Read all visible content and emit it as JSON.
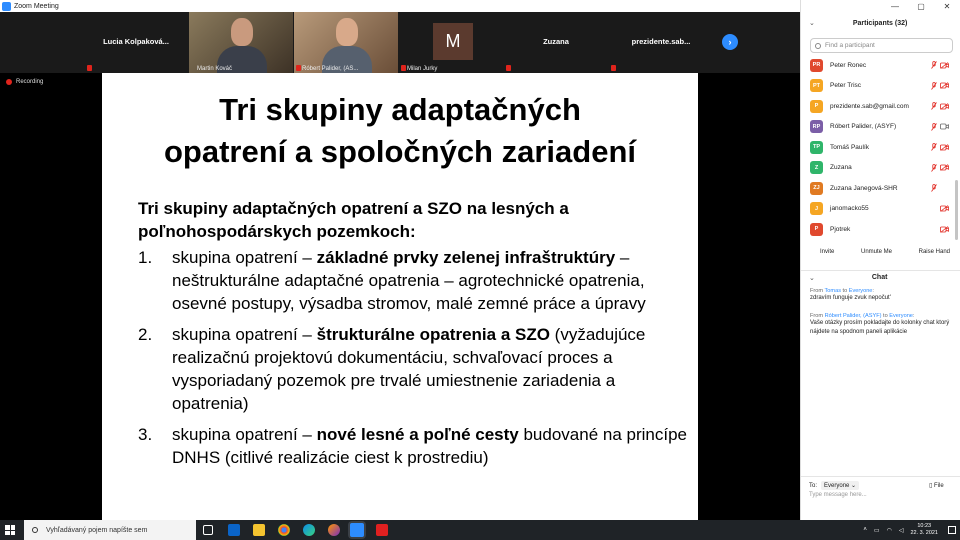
{
  "window": {
    "title": "Zoom Meeting"
  },
  "video_strip": {
    "tiles": [
      {
        "name": "Lucia  Kolpaková..."
      },
      {
        "label": "Martin Kováč"
      },
      {
        "label": "Róbert Palider, (AS..."
      },
      {
        "initial": "M",
        "label": "Milan Jurky"
      },
      {
        "name": "Zuzana"
      },
      {
        "name": "prezidente.sab..."
      }
    ],
    "next_icon": "chevron-right-icon"
  },
  "recording": {
    "label": "Recording"
  },
  "slide": {
    "title_line1": "Tri skupiny adaptačných",
    "title_line2": "opatrení a spoločných zariadení",
    "intro": "Tri skupiny adaptačných opatrení a SZO na lesných a poľnohospodárskych pozemkoch:",
    "items": [
      {
        "num": "1.",
        "pre": "skupina opatrení – ",
        "bold": "základné prvky zelenej infraštruktúry",
        "post": " – neštrukturálne adaptačné opatrenia – agrotechnické opatrenia, osevné postupy, výsadba stromov, malé zemné práce a úpravy"
      },
      {
        "num": "2.",
        "pre": "skupina opatrení – ",
        "bold": "štrukturálne opatrenia a SZO",
        "post": " (vyžadujúce realizačnú projektovú dokumentáciu, schvaľovací proces a vysporiadaný pozemok pre trvalé umiestnenie zariadenia a opatrenia)"
      },
      {
        "num": "3.",
        "pre": "skupina opatrení – ",
        "bold": "nové lesné a poľné cesty",
        "post": " budované na princípe DNHS (citlivé realizácie ciest k prostrediu)"
      }
    ]
  },
  "participants": {
    "header": "Participants (32)",
    "search_placeholder": "Find a participant",
    "list": [
      {
        "initials": "PR",
        "name": "Peter Ronec",
        "color": "#e0492e",
        "mic": "muted",
        "cam": "off"
      },
      {
        "initials": "PT",
        "name": "Peter Trisc",
        "color": "#f5a623",
        "mic": "muted",
        "cam": "off"
      },
      {
        "initials": "P",
        "name": "prezidente.sab@gmail.com",
        "color": "#f5a623",
        "mic": "muted",
        "cam": "off"
      },
      {
        "initials": "RP",
        "name": "Róbert Palider, (ASYF)",
        "color": "#7b5ea7",
        "mic": "muted",
        "cam": "on"
      },
      {
        "initials": "TP",
        "name": "Tomáš Paulík",
        "color": "#2fb56a",
        "mic": "muted",
        "cam": "off"
      },
      {
        "initials": "Z",
        "name": "Zuzana",
        "color": "#2fb56a",
        "mic": "muted",
        "cam": "off"
      },
      {
        "initials": "ZJ",
        "name": "Zuzana Janegová-SHR",
        "color": "#e07a22",
        "mic": "muted",
        "cam": ""
      },
      {
        "initials": "J",
        "name": "janomacko55",
        "color": "#f5a623",
        "mic": "",
        "cam": "off"
      },
      {
        "initials": "P",
        "name": "Pjotrek",
        "color": "#e0492e",
        "mic": "",
        "cam": "off"
      }
    ],
    "buttons": {
      "invite": "Invite",
      "unmute": "Unmute Me",
      "raise": "Raise Hand"
    }
  },
  "chat": {
    "header": "Chat",
    "messages": [
      {
        "from_label": "From ",
        "from": "Tomas",
        "to_label": " to ",
        "to": "Everyone",
        "to_suffix": ":",
        "text": "zdravím funguje zvuk nepočut'"
      },
      {
        "from_label": "From ",
        "from": "Róbert Palider, (ASYF)",
        "to_label": " to ",
        "to": "Everyone",
        "to_suffix": ":",
        "text": "Vaše otázky prosím pokladajte do kolonky chat ktorý nájdete na spodnom paneli aplikácie"
      }
    ],
    "to_label": "To:",
    "recipient": "Everyone",
    "file_label": "File",
    "input_placeholder": "Type message here..."
  },
  "taskbar": {
    "search_placeholder": "Vyhľadávaný pojem napíšte sem",
    "time": "10:23",
    "date": "22. 3. 2021",
    "notification_count": "2"
  },
  "colors": {
    "zoom_blue": "#2d8cff",
    "muted_red": "#e0241c",
    "active_speaker": "#5fd04e"
  }
}
